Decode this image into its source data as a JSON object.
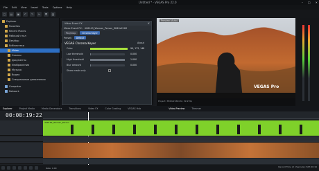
{
  "window": {
    "title": "Untitled * - VEGAS Pro 22.0",
    "controls": [
      "minimize-icon",
      "maximize-icon",
      "close-icon"
    ]
  },
  "menu": [
    "File",
    "Edit",
    "View",
    "Insert",
    "Tools",
    "Options",
    "Help"
  ],
  "explorer": {
    "tree": [
      "Explorer",
      "Favorites",
      "Recent Places",
      "Рабочий стол",
      "Desktop",
      "Библиотеки",
      "Video",
      "Сеансы",
      "Документы",
      "Изображения",
      "Музыка",
      "Видео",
      "Специальные дополнения",
      "Computer",
      "Network"
    ],
    "selected": "Video"
  },
  "fx": {
    "header": "Video Event FX",
    "chain_label": "Video Event FX:",
    "chain_value": "406149_Woman_Person_3840x2160",
    "pills": [
      "Pan/Crop",
      "Chroma Keyer"
    ],
    "preset_label": "Preset:",
    "preset_value": "Default",
    "plugin_name": "VEGAS Chroma Keyer",
    "about": "About",
    "params": [
      {
        "label": "Color",
        "value": "99, 173, 148"
      },
      {
        "label": "Low threshold",
        "value": "0.000"
      },
      {
        "label": "High threshold",
        "value": "1.000"
      },
      {
        "label": "Blur amount",
        "value": "0.000"
      }
    ],
    "show_mask": "Show mask only"
  },
  "preview": {
    "label": "Preview (Auto)",
    "logo": "VEGAS Pro",
    "fps": "Project: 3840x2160x32, 29.970p"
  },
  "tabs": [
    "Explorer",
    "Project Media",
    "Media Generators",
    "Transitions",
    "Video FX",
    "Color Grading",
    "VEGAS Hub",
    "Video Preview",
    "Trimmer"
  ],
  "active_tab": "Explorer",
  "timeline": {
    "timecode": "00:00:19:22",
    "clip_name": "406149_Woman_Person",
    "rate": "Rate: 0.00",
    "record_time": "Record Time (2 channels): 847:26:16"
  },
  "colors": {
    "keygreen": "#7fd12a",
    "accent": "#2d6fc4"
  }
}
